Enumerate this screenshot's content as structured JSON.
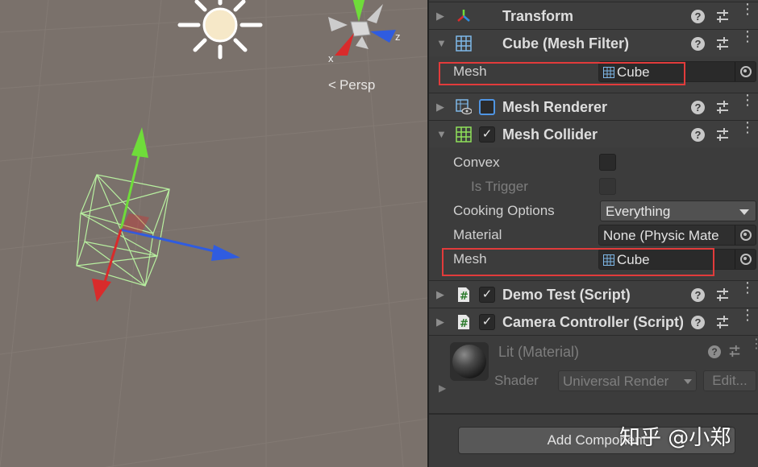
{
  "scene": {
    "persp_label": "Persp",
    "gizmo_axes": {
      "x": "x",
      "z": "z"
    },
    "colors": {
      "background": "#7a716b",
      "x_axis": "#d92b2b",
      "y_axis": "#6fdc3a",
      "z_axis": "#2f5ce0",
      "wireframe": "#b8f0a0"
    }
  },
  "inspector": {
    "components": [
      {
        "title": "Transform"
      },
      {
        "title": "Cube (Mesh Filter)"
      },
      {
        "title": "Mesh Renderer"
      },
      {
        "title": "Mesh Collider"
      },
      {
        "title": "Demo Test (Script)"
      },
      {
        "title": "Camera Controller (Script)"
      }
    ],
    "mesh_filter": {
      "mesh_label": "Mesh",
      "mesh_value": "Cube"
    },
    "mesh_collider": {
      "convex_label": "Convex",
      "is_trigger_label": "Is Trigger",
      "cooking_label": "Cooking Options",
      "cooking_value": "Everything",
      "material_label": "Material",
      "material_value": "None (Physic Mate",
      "mesh_label": "Mesh",
      "mesh_value": "Cube"
    },
    "material": {
      "title": "Lit (Material)",
      "shader_label": "Shader",
      "shader_value": "Universal Render",
      "edit_label": "Edit..."
    },
    "add_component_label": "Add Component",
    "highlight_color": "#e23b3b"
  },
  "watermark": "知乎 @小郑"
}
